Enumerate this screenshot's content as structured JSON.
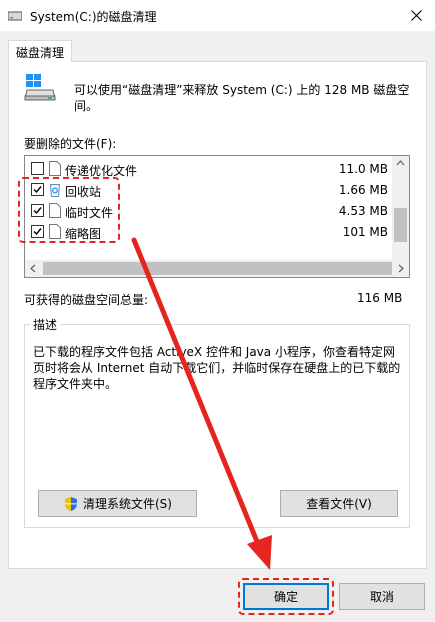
{
  "window": {
    "title": "System(C:)的磁盘清理",
    "close_icon": "close-icon"
  },
  "tab": {
    "label": "磁盘清理"
  },
  "intro": {
    "text": "可以使用“磁盘清理”来释放 System (C:) 上的 128 MB 磁盘空间。"
  },
  "files": {
    "label": "要删除的文件(F):",
    "items": [
      {
        "name": "传递优化文件",
        "size": "11.0 MB",
        "checked": false,
        "icon": "file-icon"
      },
      {
        "name": "回收站",
        "size": "1.66 MB",
        "checked": true,
        "icon": "recycle-bin-icon"
      },
      {
        "name": "临时文件",
        "size": "4.53 MB",
        "checked": true,
        "icon": "file-icon"
      },
      {
        "name": "缩略图",
        "size": "101 MB",
        "checked": true,
        "icon": "file-icon"
      }
    ]
  },
  "total": {
    "label": "可获得的磁盘空间总量:",
    "value": "116 MB"
  },
  "description": {
    "title": "描述",
    "text": "已下载的程序文件包括 ActiveX 控件和 Java 小程序，你查看特定网页时将会从 Internet 自动下载它们，并临时保存在硬盘上的已下载的程序文件夹中。"
  },
  "buttons": {
    "clean_system": "清理系统文件(S)",
    "view_files": "查看文件(V)",
    "ok": "确定",
    "cancel": "取消"
  },
  "colors": {
    "annotation": "#e52520",
    "accent": "#0078d7"
  }
}
